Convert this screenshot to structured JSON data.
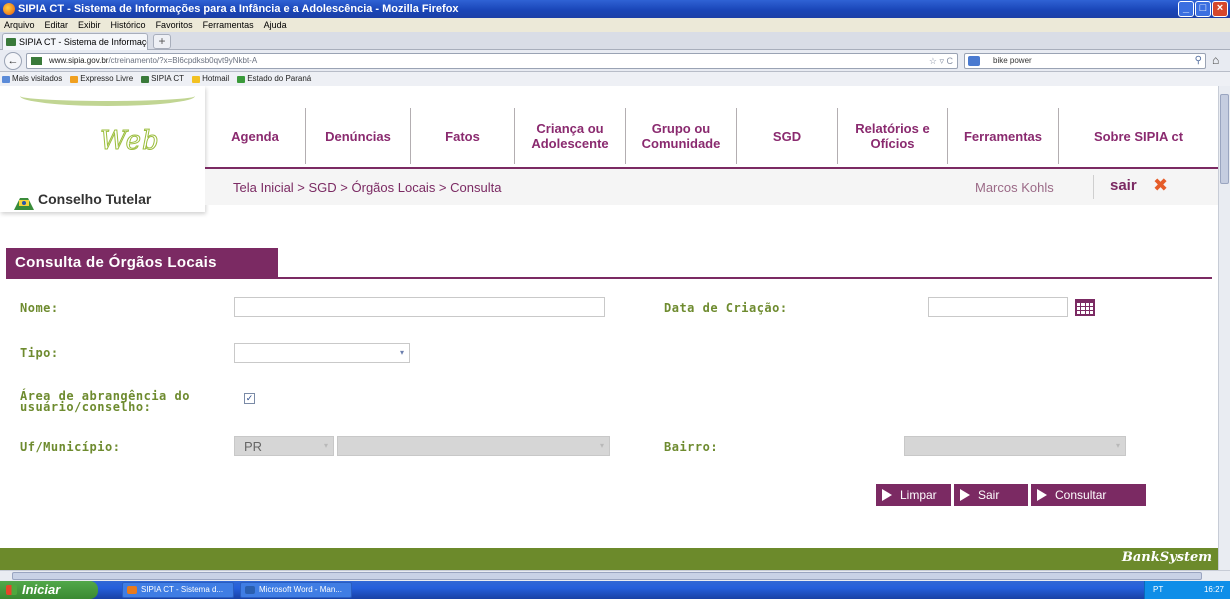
{
  "window": {
    "title": "SIPIA CT - Sistema de Informações para a Infância e a Adolescência - Mozilla Firefox",
    "controls": [
      "_",
      "□",
      "×"
    ]
  },
  "menubar": [
    "Arquivo",
    "Editar",
    "Exibir",
    "Histórico",
    "Favoritos",
    "Ferramentas",
    "Ajuda"
  ],
  "browser_tab": {
    "label": "SIPIA CT - Sistema de Informações para a I...",
    "new_tab": "+"
  },
  "navbar": {
    "back": "←",
    "url_domain": "www.sipia.gov.br",
    "url_path": "/ctreinamento/?x=Bl6cpdksb0qvt9yNkbt-A",
    "url_icons": "☆ ▿ C",
    "search_value": "bike power",
    "search_icon": "⚲",
    "home": "⌂"
  },
  "bookmarks": [
    {
      "label": "Mais visitados",
      "color": "#5b8bd8"
    },
    {
      "label": "Expresso Livre",
      "color": "#f0a020"
    },
    {
      "label": "SIPIA CT",
      "color": "#3a7a3a"
    },
    {
      "label": "Hotmail",
      "color": "#f2c122"
    },
    {
      "label": "Estado do Paraná",
      "color": "#3a9a3a"
    }
  ],
  "site": {
    "logo_web": "Web",
    "logo_sub": "Conselho Tutelar",
    "nav": [
      {
        "label": "Agenda"
      },
      {
        "label": "Denúncias"
      },
      {
        "label": "Fatos"
      },
      {
        "label": "Criança ou Adolescente"
      },
      {
        "label": "Grupo ou Comunidade"
      },
      {
        "label": "SGD"
      },
      {
        "label": "Relatórios e Ofícios"
      },
      {
        "label": "Ferramentas"
      },
      {
        "label": "Sobre SIPIA ct"
      }
    ],
    "breadcrumb": "Tela Inicial > SGD > Órgãos Locais > Consulta",
    "user": "Marcos Kohls",
    "logout": "sair",
    "logout_icon": "✖"
  },
  "form": {
    "title": "Consulta de Órgãos Locais",
    "nome_label": "Nome:",
    "nome_value": "",
    "data_label": "Data de Criação:",
    "data_value": "",
    "tipo_label": "Tipo:",
    "tipo_value": "",
    "area_label_1": "Área de abrangência do",
    "area_label_2": "usuário/conselho:",
    "area_checked": true,
    "area_check_glyph": "✓",
    "uf_label": "Uf/Município:",
    "uf_value": "PR",
    "municipio_value": "",
    "bairro_label": "Bairro:",
    "bairro_value": "",
    "dropdown_glyph": "▾",
    "buttons": {
      "limpar": "Limpar",
      "sair": "Sair",
      "consultar": "Consultar"
    }
  },
  "footer": {
    "brand": "BankSystem"
  },
  "taskbar": {
    "start": "Iniciar",
    "items": [
      {
        "label": "SIPIA CT - Sistema d...",
        "color": "#e87a1e"
      },
      {
        "label": "Microsoft Word - Man...",
        "color": "#2a5fb0"
      }
    ],
    "tray": "PT",
    "clock": "16:27"
  },
  "colors": {
    "accent_purple": "#7b2a63",
    "label_green": "#6e8b2f",
    "footer_green": "#6c8a2b"
  }
}
